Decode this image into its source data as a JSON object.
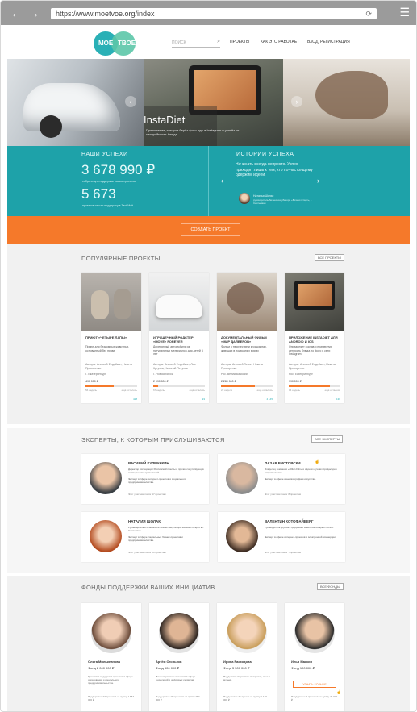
{
  "browser": {
    "url": "https://www.moetvoe.org/index",
    "back": "←",
    "forward": "→",
    "reload": "⟳",
    "menu": "☰"
  },
  "header": {
    "logo_left": "МОЁ",
    "logo_right": "ТВОЁ",
    "search_placeholder": "ПОИСК",
    "nav": [
      "ПРОЕКТЫ",
      "КАК ЭТО РАБОТАЕТ",
      "ВХОД",
      "РЕГИСТРАЦИЯ"
    ]
  },
  "slider": {
    "caption": "InstaDiet",
    "caption_sub": "Приложение, которое берёт фото еды в Instagram и узнаёт их калорийность блюда"
  },
  "stats": {
    "left_title": "НАШИ УСПЕХИ",
    "amount": "3 678 990 ₽",
    "amount_note": "собрано для поддержки наших проектов",
    "count": "5 673",
    "count_note": "проектов нашли поддержку в ТвоёМоё",
    "right_title": "ИСТОРИИ УСПЕХА",
    "quote": "Начинать всегда непросто. Успех приходит лишь к тем, кто по-настоящему одержим идеей.",
    "author": "Наталья Шолак",
    "author_role": "руководитель бизнес-инкубатора «Бизнес-Старт», г. Сыктывкар"
  },
  "cta": {
    "label": "СОЗДАТЬ ПРОЕКТ"
  },
  "popular": {
    "title": "ПОПУЛЯРНЫЕ ПРОЕКТЫ",
    "all": "ВСЕ ПРОЕКТЫ",
    "cards": [
      {
        "title": "ПРИЮТ «ЧЕТЫРЕ ЛАПЫ»",
        "desc": "Приют для бездомных животных, основанный без права",
        "authors": "Авторы: Алексей Федейкин, Никита Прохоренко",
        "city": "Г. Екатеринбург",
        "amount": "490 000 ₽",
        "pct": 0.55,
        "left": "56 недель",
        "status": "ещё осталось",
        "views": "428"
      },
      {
        "title": "ИГРУШЕЧНЫЙ РОДСТЕР «MOVE» FOREVER",
        "desc": "Деревянный автомобиль из натуральных материалов для детей 5 лет",
        "authors": "Авторы: Алексей Федейкин, Лев Кутузов, Николай Петухов",
        "city": "Г. Новосибирск",
        "amount": "2 990 000 ₽",
        "pct": 0.1,
        "left": "67 недель",
        "status": "ещё осталось",
        "views": "93"
      },
      {
        "title": "ДОКУМЕНТАЛЬНЫЙ ФИЛЬМ «МИР ДАЙВЕРОВ»",
        "desc": "Фильм о творчестве и музыкантах, живущих в подводных мирах",
        "authors": "Авторы: Алексей Лесин, Никита Прохоренко",
        "city": "Рос. Великокамский",
        "amount": "2 280 000 ₽",
        "pct": 0.65,
        "left": "22 недели",
        "status": "ещё осталось",
        "views": "4 145"
      },
      {
        "title": "ПРИЛОЖЕНИЕ INSTADIET ДЛЯ ANDROID И IOS",
        "desc": "Определяет состав и примерную ценность блюда по фото в сети Instagram",
        "authors": "Авторы: Алексей Федейкин, Никита Прохоренко",
        "city": "Рос. Екатеринбург",
        "amount": "190 000 ₽",
        "pct": 0.8,
        "left": "14 недель",
        "status": "ещё осталось",
        "views": "136"
      }
    ]
  },
  "experts": {
    "title": "ЭКСПЕРТЫ, К КОТОРЫМ ПРИСЛУШИВАЮТСЯ",
    "all": "ВСЕ ЭКСПЕРТЫ",
    "cards": [
      {
        "name": "ВАСИЛИЙ КУЛЕБЯКИН",
        "line1": "Директор Ассоциации Российской прессы и прочих сопутствующих коммерческих организаций.",
        "line2": "Эксперт в сфере интернет-проектов и социального предпринимательства.",
        "foot": "Этот участник помог 17 проектам"
      },
      {
        "name": "ЛАЗАР РИСТОВСКИ",
        "line1": "Владелец компании «Zillion Film» и один из лучших продюсеров современности.",
        "line2": "Эксперт в сфере кинематографа и искусства.",
        "foot": "Этот участник помог 8 проектам"
      },
      {
        "name": "НАТАЛИЯ ШОЛАК",
        "line1": "Руководитель и основатель бизнес-инкубатора «Бизнес-Старт» в г. Сыктывкар.",
        "line2": "Эксперт в сфере социальных бизнес-проектов и предпринимательства.",
        "foot": "Этот участник помог 20 проектам"
      },
      {
        "name": "ВАЛЕНТИН КОТОФАЙБЕРГ",
        "line1": "Руководитель крупного цифрового агентства «Маркет-Холл».",
        "line2": "Эксперт в сфере интернет-проектов и электронной коммерции.",
        "foot": "Этот участник помог 7 проектам"
      }
    ]
  },
  "funds": {
    "title": "ФОНДЫ ПОДДЕРЖКИ ВАШИХ ИНИЦИАТИВ",
    "all": "ВСЕ ФОНДЫ",
    "more": "УЗНАТЬ БОЛЬШЕ",
    "cards": [
      {
        "name": "Ольга Милькевнова",
        "amount": "Фонд 2 000 000 ₽",
        "desc": "Грантовая поддержка проектов в сфере образования и социального предпринимательства.",
        "sup": "Поддержано 27 проектов на сумму 1 564 000 ₽"
      },
      {
        "name": "Артём Огоньков",
        "amount": "Фонд 500 000 ₽",
        "desc": "Финансирование проектов в сфере технологий и цифровых сервисов.",
        "sup": "Поддержано 11 проектов на сумму 250 000 ₽"
      },
      {
        "name": "Ирина Расходова",
        "amount": "Фонд 3 500 000 ₽",
        "desc": "Поддержка творческих инициатив, кино и музыки.",
        "sup": "Поддержано 41 проект на сумму 1 170 000 ₽"
      },
      {
        "name": "Илья Маскин",
        "amount": "Фонд 100 000 ₽",
        "desc": "Инвестиции в транспортные и инженерные проекты.",
        "sup": "Поддержано 9 проектов на сумму 45 000 ₽"
      }
    ]
  }
}
